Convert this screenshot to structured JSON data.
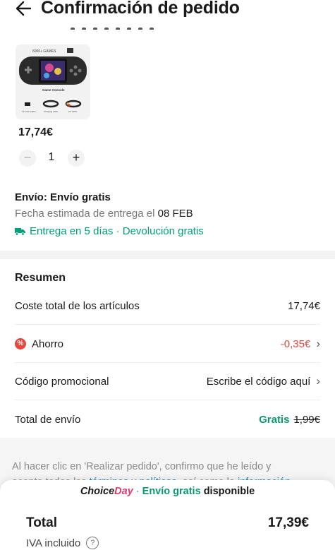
{
  "header": {
    "title": "Confirmación de pedido",
    "back_icon": "arrow-left-icon"
  },
  "product": {
    "image_text": {
      "badge": "6000+ GAMES",
      "caption": "Game Console",
      "accessories": [
        "TF card reader",
        "Charging cable",
        "AV Cable"
      ]
    },
    "price": "17,74€",
    "quantity": "1",
    "minus": "−",
    "plus": "+"
  },
  "shipping": {
    "title": "Envío: Envío gratis",
    "date_label": "Fecha estimada de entrega el",
    "date_value": "08 FEB",
    "delivery": "Entrega en 5 días · Devolución gratis",
    "accent_color": "#00a079"
  },
  "summary": {
    "title": "Resumen",
    "items_label": "Coste total de los artículos",
    "items_value": "17,74€",
    "discount_label": "Ahorro",
    "discount_value": "-0,35€",
    "promo_label": "Código promocional",
    "promo_value": "Escribe el código aquí",
    "shipping_label": "Total de envío",
    "shipping_value": "Gratis",
    "shipping_original": "1,99€"
  },
  "legal": {
    "line1": "Al hacer clic en 'Realizar pedido', confirmo que he leído y",
    "line2_prefix": "acepto todos los",
    "link1": "términos y políticas",
    "line2_mid": ", así como la",
    "link2": "información"
  },
  "footer": {
    "choice": "Choice",
    "day": "Day",
    "separator": " · ",
    "free_shipping": "Envío gratis",
    "available": "disponible",
    "total_label": "Total",
    "total_value": "17,39€",
    "vat_label": "IVA incluido",
    "help": "?"
  }
}
